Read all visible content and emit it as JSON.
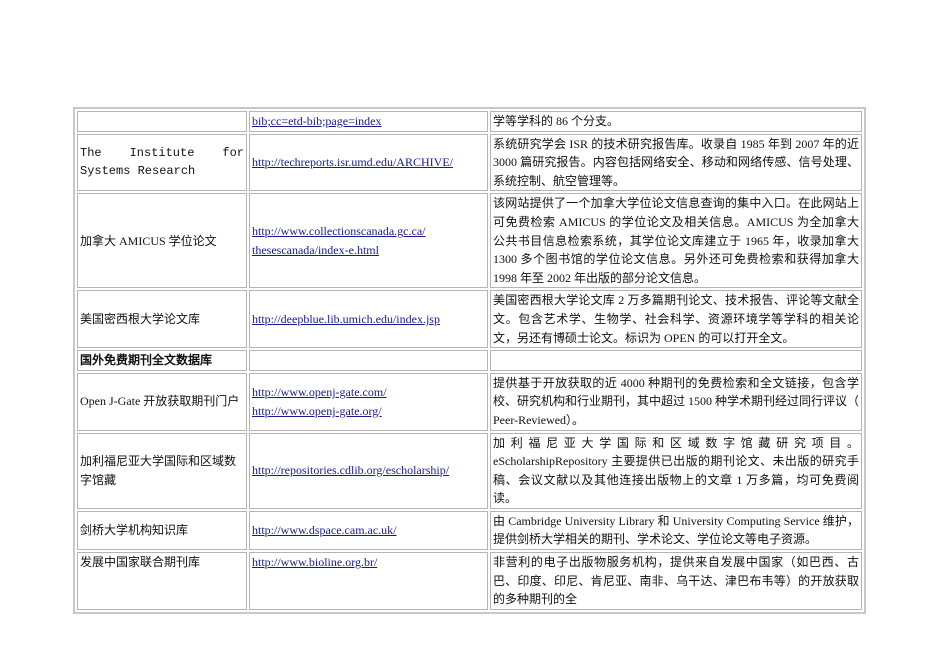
{
  "table": {
    "rows": [
      {
        "name": "",
        "urls": [
          "bib;cc=etd-bib;page=index"
        ],
        "desc": "学等学科的 86 个分支。"
      },
      {
        "name": "The Institute for",
        "name2": "Systems Research",
        "urls": [
          "http://techreports.isr.umd.edu/ARCHIVE/"
        ],
        "desc": "系统研究学会 ISR 的技术研究报告库。收录自 1985 年到 2007 年的近 3000 篇研究报告。内容包括网络安全、移动和网络传感、信号处理、系统控制、航空管理等。"
      },
      {
        "name": "加拿大 AMICUS 学位论文",
        "urls": [
          "http://www.collectionscanada.gc.ca/",
          "thesescanada/index-e.html"
        ],
        "desc": "该网站提供了一个加拿大学位论文信息查询的集中入口。在此网站上可免费检索 AMICUS 的学位论文及相关信息。AMICUS 为全加拿大公共书目信息检索系统，其学位论文库建立于 1965 年，收录加拿大 1300 多个图书馆的学位论文信息。另外还可免费检索和获得加拿大 1998 年至 2002 年出版的部分论文信息。"
      },
      {
        "name": "美国密西根大学论文库",
        "urls": [
          "http://deepblue.lib.umich.edu/index.jsp"
        ],
        "desc": "美国密西根大学论文库 2 万多篇期刊论文、技术报告、评论等文献全文。包含艺术学、生物学、社会科学、资源环境学等学科的相关论文，另还有博硕士论文。标识为 OPEN 的可以打开全文。"
      },
      {
        "section": "国外免费期刊全文数据库"
      },
      {
        "name": "Open J-Gate 开放获取期刊门户",
        "urls": [
          "http://www.openj-gate.com/",
          "http://www.openj-gate.org/"
        ],
        "desc": "提供基于开放获取的近 4000 种期刊的免费检索和全文链接，包含学校、研究机构和行业期刊，其中超过 1500 种学术期刊经过同行评议（ Peer-Reviewed）。"
      },
      {
        "name": "加利福尼亚大学国际和区域数字馆藏",
        "urls": [
          "http://repositories.cdlib.org/escholarship/"
        ],
        "desc": "加利福尼亚大学国际和区域数字馆藏研究项目。eScholarshipRepository 主要提供已出版的期刊论文、未出版的研究手稿、会议文献以及其他连接出版物上的文章 1 万多篇，均可免费阅读。"
      },
      {
        "name": "剑桥大学机构知识库",
        "urls": [
          "http://www.dspace.cam.ac.uk/"
        ],
        "desc": "由 Cambridge University Library 和 University Computing Service 维护，提供剑桥大学相关的期刊、学术论文、学位论文等电子资源。"
      },
      {
        "name": "发展中国家联合期刊库",
        "urls": [
          "http://www.bioline.org.br/"
        ],
        "desc": "非营利的电子出版物服务机构，提供来自发展中国家（如巴西、古巴、印度、印尼、肯尼亚、南非、乌干达、津巴布韦等）的开放获取的多种期刊的全"
      }
    ]
  }
}
